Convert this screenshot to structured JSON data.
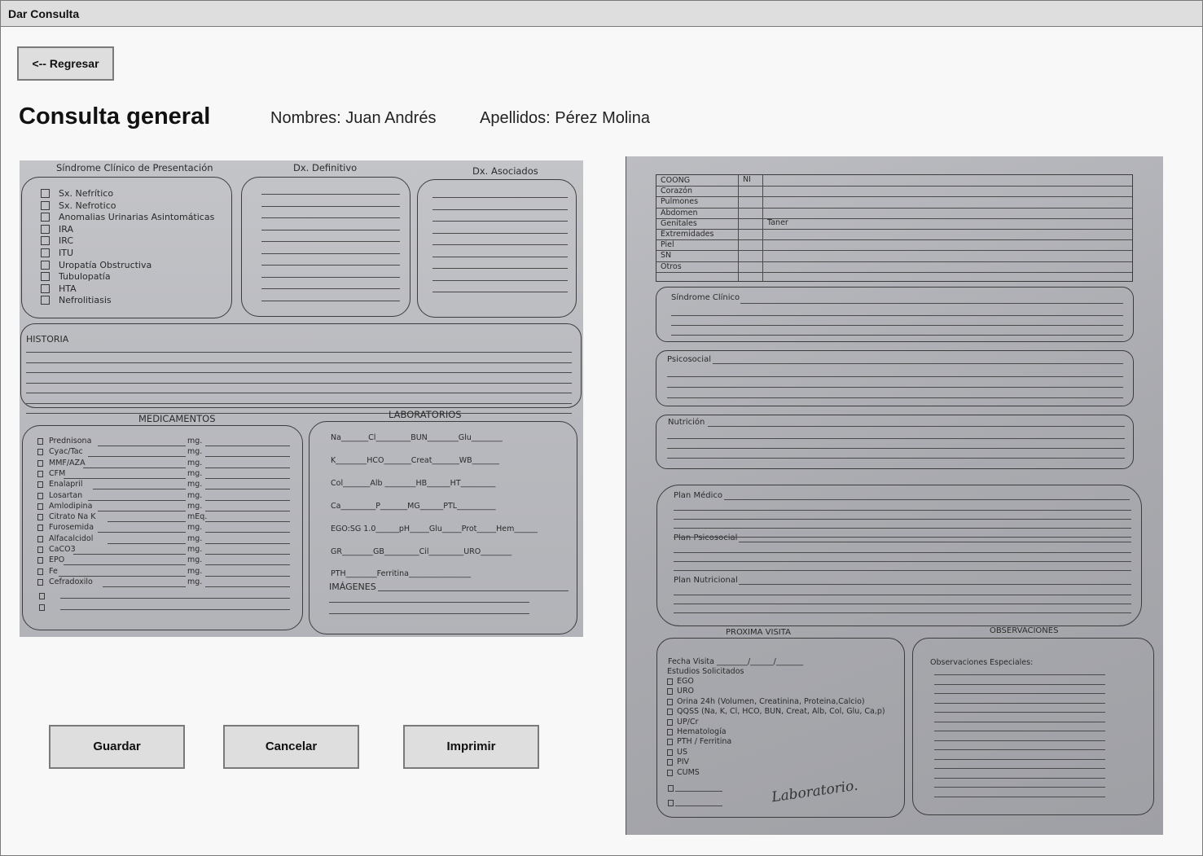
{
  "window": {
    "title": "Dar Consulta"
  },
  "toolbar": {
    "back_label": "<-- Regresar"
  },
  "header": {
    "title": "Consulta general",
    "names": "Nombres: Juan Andrés",
    "surnames": "Apellidos: Pérez Molina"
  },
  "actions": {
    "save": "Guardar",
    "cancel": "Cancelar",
    "print": "Imprimir"
  },
  "form_left": {
    "syndrome_title": "Síndrome Clínico de Presentación",
    "syndrome_items": [
      "Sx. Nefrítico",
      "Sx. Nefrotico",
      "Anomalias Urinarias Asintomáticas",
      "IRA",
      "IRC",
      "ITU",
      "Uropatía Obstructiva",
      "Tubulopatía",
      "HTA",
      "Nefrolitiasis"
    ],
    "dx_definitivo": "Dx. Definitivo",
    "dx_asociados": "Dx. Asociados",
    "historia": "HISTORIA",
    "medicamentos_title": "MEDICAMENTOS",
    "medicamentos": [
      {
        "name": "Prednisona",
        "unit": "mg."
      },
      {
        "name": "Cyac/Tac",
        "unit": "mg."
      },
      {
        "name": "MMF/AZA",
        "unit": "mg."
      },
      {
        "name": "CFM",
        "unit": "mg."
      },
      {
        "name": "Enalapril",
        "unit": "mg."
      },
      {
        "name": "Losartan",
        "unit": "mg."
      },
      {
        "name": "Amlodipina",
        "unit": "mg."
      },
      {
        "name": "Citrato Na K",
        "unit": "mEq."
      },
      {
        "name": "Furosemida",
        "unit": "mg."
      },
      {
        "name": "Alfacalcidol",
        "unit": "mg."
      },
      {
        "name": "CaCO3",
        "unit": "mg."
      },
      {
        "name": "EPO",
        "unit": "mg."
      },
      {
        "name": "Fe",
        "unit": "mg."
      },
      {
        "name": "Cefradoxilo",
        "unit": "mg."
      }
    ],
    "laboratorios_title": "LABORATORIOS",
    "lab_rows": [
      "Na_______Cl_________BUN________Glu________",
      "K________HCO_______Creat_______WB_______",
      "Col_______Alb ________HB______HT_________",
      "Ca_________P_______MG______PTL__________",
      "EGO:SG 1.0______pH_____Glu_____Prot_____Hem______",
      "GR________GB_________Cil_________URO________",
      "PTH________Ferritina________________"
    ],
    "imagenes": "IMÁGENES"
  },
  "form_right": {
    "exam_rows": [
      "COONG",
      "Corazón",
      "Pulmones",
      "Abdomen",
      "Genitales",
      "Extremidades",
      "Piel",
      "SN",
      "Otros"
    ],
    "exam_col_header": "NI",
    "genitales_note": "Taner",
    "sindrome_clinico": "Síndrome Clínico",
    "psicosocial": "Psicosocial",
    "nutricion": "Nutrición",
    "plan_medico": "Plan Médico",
    "plan_psicosocial": "Plan Psicosocial",
    "plan_nutricional": "Plan Nutricional",
    "proxima_visita": "PROXIMA VISITA",
    "observaciones": "OBSERVACIONES",
    "fecha_visita": "Fecha Visita ________/______/_______",
    "estudios": "Estudios Solicitados",
    "estudios_items": [
      "EGO",
      "URO",
      "Orina 24h (Volumen, Creatinina,  Proteina,Calcio)",
      "QQSS (Na, K, Cl, HCO, BUN, Creat, Alb, Col, Glu, Ca,p)",
      "UP/Cr",
      "Hematología",
      "PTH / Ferritina",
      "US",
      "PIV",
      "CUMS"
    ],
    "obs_especiales": "Observaciones Especiales:",
    "handwriting": "Laboratorio."
  }
}
